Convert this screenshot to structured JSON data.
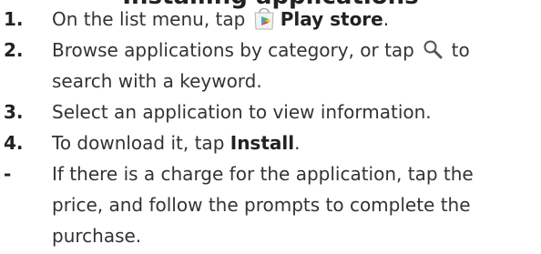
{
  "heading_fragment": "Installing applications",
  "steps": [
    {
      "marker": "1.",
      "text_before": "On the list menu, tap ",
      "bold": "Play store",
      "text_after": ".",
      "icon": "play-store-icon"
    },
    {
      "marker": "2.",
      "text_before": "Browse applications by category, or tap ",
      "text_after": " to",
      "line2": "search with a keyword.",
      "icon": "search-icon"
    },
    {
      "marker": "3.",
      "text": "Select an application to view information."
    },
    {
      "marker": "4.",
      "text_before": "To download it, tap ",
      "bold": "Install",
      "text_after": "."
    },
    {
      "marker": "-",
      "lines": [
        "If there is a charge for the application, tap the",
        "price, and follow the prompts to complete the",
        "purchase."
      ]
    }
  ],
  "colors": {
    "text": "#333333",
    "search_icon": "#555555"
  }
}
